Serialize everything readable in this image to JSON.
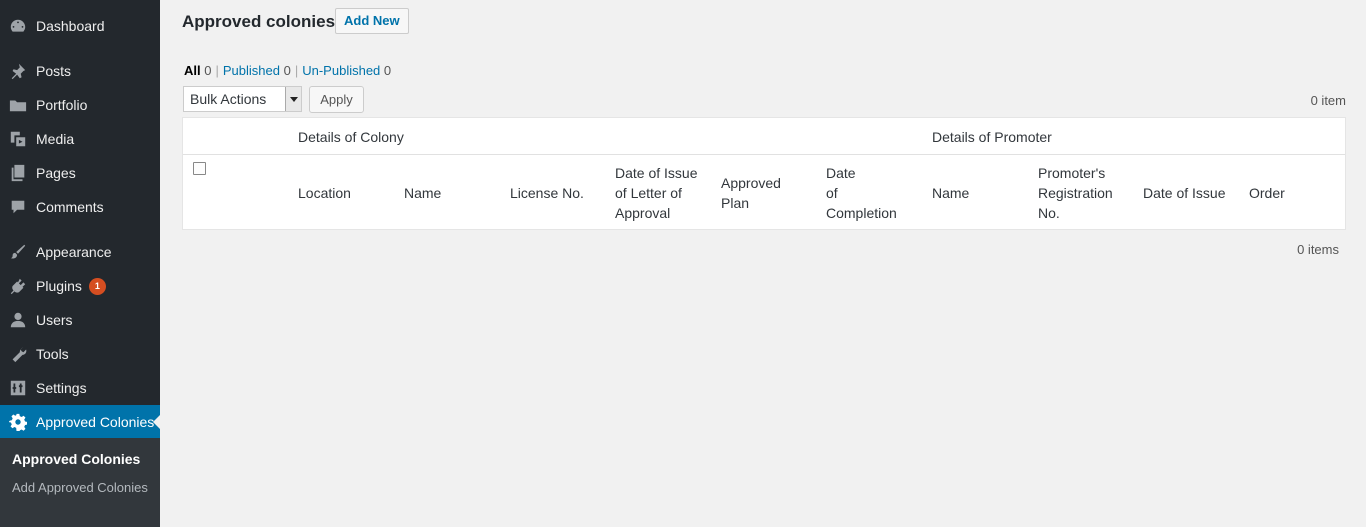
{
  "sidebar": {
    "items": [
      {
        "label": "Dashboard",
        "icon": "dashboard-icon"
      },
      {
        "label": "Posts",
        "icon": "pushpin-icon"
      },
      {
        "label": "Portfolio",
        "icon": "folder-icon"
      },
      {
        "label": "Media",
        "icon": "media-icon"
      },
      {
        "label": "Pages",
        "icon": "pages-icon"
      },
      {
        "label": "Comments",
        "icon": "comment-icon"
      },
      {
        "label": "Appearance",
        "icon": "paintbrush-icon"
      },
      {
        "label": "Plugins",
        "icon": "plug-icon",
        "badge": "1"
      },
      {
        "label": "Users",
        "icon": "user-icon"
      },
      {
        "label": "Tools",
        "icon": "wrench-icon"
      },
      {
        "label": "Settings",
        "icon": "sliders-icon"
      },
      {
        "label": "Approved Colonies",
        "icon": "gear-icon",
        "current": true
      }
    ],
    "submenu": [
      {
        "label": "Approved Colonies",
        "current": true
      },
      {
        "label": "Add Approved Colonies"
      }
    ]
  },
  "header": {
    "title": "Approved colonies",
    "add_new": "Add New"
  },
  "filters": {
    "all_label": "All",
    "all_count": "0",
    "published_label": "Published",
    "published_count": "0",
    "unpublished_label": "Un-Published",
    "unpublished_count": "0"
  },
  "bulk": {
    "selected": "Bulk Actions",
    "apply": "Apply"
  },
  "items_top": "0 item",
  "items_bottom": "0 items",
  "table": {
    "group_headers": [
      "Details of Colony",
      "Details of Promoter"
    ],
    "columns": [
      [
        "Location"
      ],
      [
        "Name"
      ],
      [
        "License No."
      ],
      [
        "Date of Issue",
        "of Letter of",
        "Approval"
      ],
      [
        "Approved",
        "Plan"
      ],
      [
        "Date",
        "of",
        "Completion"
      ],
      [
        "Name"
      ],
      [
        "Promoter's",
        "Registration",
        "No."
      ],
      [
        "Date of Issue"
      ],
      [
        "Order"
      ]
    ]
  },
  "colors": {
    "sidebar_bg": "#23282d",
    "accent": "#0073aa",
    "badge": "#d54e21"
  }
}
